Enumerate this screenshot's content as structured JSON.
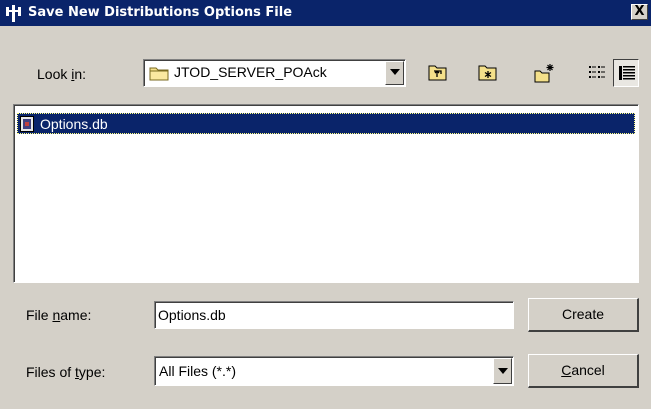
{
  "window": {
    "title": "Save New Distributions Options File",
    "close_glyph": "X"
  },
  "look_in": {
    "label_pre": "Look ",
    "label_key": "i",
    "label_post": "n:",
    "value": "JTOD_SERVER_POAck"
  },
  "toolbar": {
    "up_folder": "up-one-level-icon",
    "home": "home-folder-icon",
    "new_folder": "new-folder-icon",
    "list_view": "list-view-icon",
    "details_view": "details-view-icon"
  },
  "files": [
    {
      "name": "Options.db",
      "selected": true,
      "icon": "database-file-icon"
    }
  ],
  "file_name": {
    "label_pre": "File ",
    "label_key": "n",
    "label_post": "ame:",
    "value": "Options.db"
  },
  "file_type": {
    "label_pre": "Files of ",
    "label_key": "t",
    "label_post": "ype:",
    "value": "All Files (*.*)"
  },
  "buttons": {
    "create": "Create",
    "cancel_key": "C",
    "cancel_rest": "ancel"
  },
  "colors": {
    "title_bar": "#0a246a",
    "selection": "#0a246a",
    "dialog_bg": "#d4d0c8"
  }
}
